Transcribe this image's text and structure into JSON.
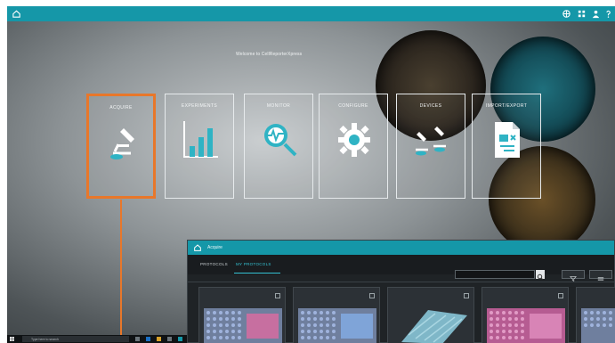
{
  "topbar": {
    "home_icon": "home-icon",
    "right_icons": [
      "globe-icon",
      "grid-icon",
      "person-icon",
      "help-icon"
    ]
  },
  "welcome": "Welcome to CellReporterXpress",
  "tiles": [
    {
      "key": "acquire",
      "label": "ACQUIRE",
      "icon": "microscope-icon",
      "desc": "",
      "selected": true
    },
    {
      "key": "experiments",
      "label": "EXPERIMENTS",
      "icon": "bar-chart-icon",
      "desc": "",
      "selected": false
    },
    {
      "key": "monitor",
      "label": "MONITOR",
      "icon": "magnifier-pulse-icon",
      "desc": "",
      "selected": false
    },
    {
      "key": "configure",
      "label": "CONFIGURE",
      "icon": "gear-icon",
      "desc": "",
      "selected": false
    },
    {
      "key": "devices",
      "label": "DEVICES",
      "icon": "microscopes-icon",
      "desc": "",
      "selected": false
    },
    {
      "key": "import-export",
      "label": "IMPORT/EXPORT",
      "icon": "document-icon",
      "desc": "",
      "selected": false
    }
  ],
  "bottom_info": {
    "lines": [
      "",
      "",
      "",
      "",
      ""
    ]
  },
  "taskbar": {
    "search_placeholder": "Type here to search"
  },
  "app": {
    "title": "Acquire",
    "tabs": [
      {
        "label": "PROTOCOLS",
        "active": false
      },
      {
        "label": "MY PROTOCOLS",
        "active": true
      }
    ],
    "search_placeholder": "",
    "cards": [
      {
        "title": "",
        "subtitle": "",
        "plate_color": "#8a9dc4"
      },
      {
        "title": "",
        "subtitle": "",
        "plate_color": "#8a9dc4"
      },
      {
        "title": "",
        "subtitle": "",
        "plate_color": "#7fb7c8"
      },
      {
        "title": "",
        "subtitle": "",
        "plate_color": "#c76fa0"
      },
      {
        "title": "",
        "subtitle": "",
        "plate_color": "#8a9dc4"
      }
    ]
  },
  "colors": {
    "accent": "#1597a8",
    "highlight": "#e8772a",
    "active_tab": "#35c3d4"
  }
}
